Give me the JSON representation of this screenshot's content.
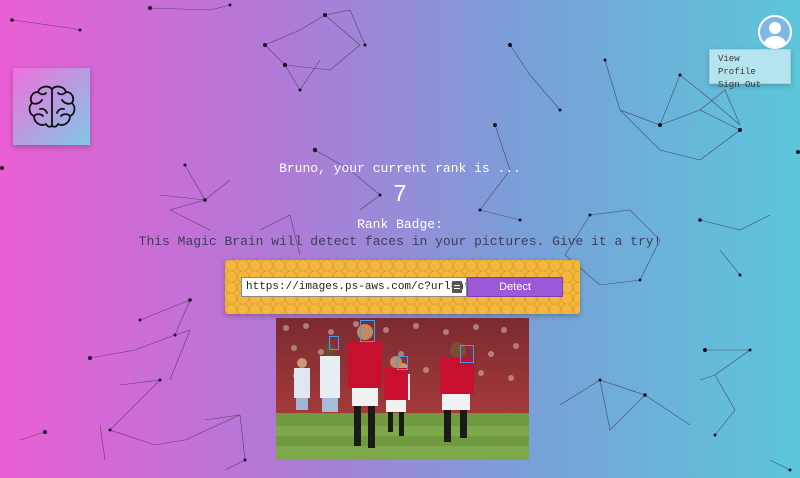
{
  "logo": {
    "icon": "brain-icon"
  },
  "profile": {
    "avatar_icon": "user-avatar-icon",
    "menu": [
      {
        "label": "View Profile"
      },
      {
        "label": "Sign Out"
      }
    ]
  },
  "rank": {
    "message": "Bruno, your current rank is ...",
    "number": "7",
    "badge_label": "Rank Badge:"
  },
  "intro": "This Magic Brain will detect faces in your pictures. Give it a try!",
  "form": {
    "url_value": "https://images.ps-aws.com/c?url=ht",
    "detect_label": "Detect"
  },
  "colors": {
    "gradient_left": "#ea5fd6",
    "gradient_right": "#5cc6da",
    "form_bg": "#f4b73e",
    "button": "#9b59d8",
    "face_box": "#3aa0f5"
  }
}
